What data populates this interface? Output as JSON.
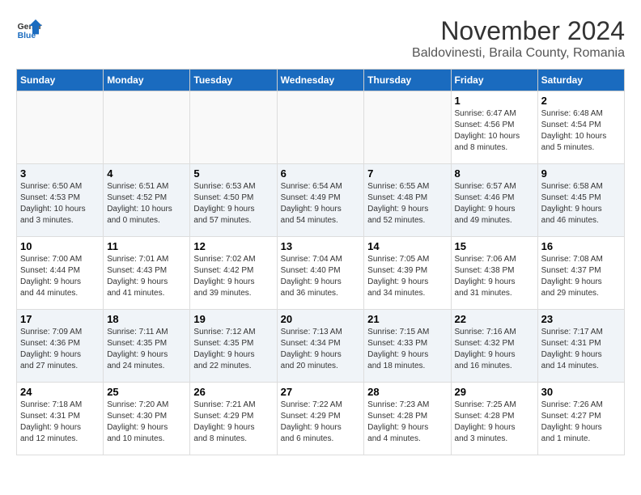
{
  "logo": {
    "general": "General",
    "blue": "Blue"
  },
  "title": "November 2024",
  "subtitle": "Baldovinesti, Braila County, Romania",
  "days_header": [
    "Sunday",
    "Monday",
    "Tuesday",
    "Wednesday",
    "Thursday",
    "Friday",
    "Saturday"
  ],
  "weeks": [
    [
      {
        "day": "",
        "info": ""
      },
      {
        "day": "",
        "info": ""
      },
      {
        "day": "",
        "info": ""
      },
      {
        "day": "",
        "info": ""
      },
      {
        "day": "",
        "info": ""
      },
      {
        "day": "1",
        "info": "Sunrise: 6:47 AM\nSunset: 4:56 PM\nDaylight: 10 hours\nand 8 minutes."
      },
      {
        "day": "2",
        "info": "Sunrise: 6:48 AM\nSunset: 4:54 PM\nDaylight: 10 hours\nand 5 minutes."
      }
    ],
    [
      {
        "day": "3",
        "info": "Sunrise: 6:50 AM\nSunset: 4:53 PM\nDaylight: 10 hours\nand 3 minutes."
      },
      {
        "day": "4",
        "info": "Sunrise: 6:51 AM\nSunset: 4:52 PM\nDaylight: 10 hours\nand 0 minutes."
      },
      {
        "day": "5",
        "info": "Sunrise: 6:53 AM\nSunset: 4:50 PM\nDaylight: 9 hours\nand 57 minutes."
      },
      {
        "day": "6",
        "info": "Sunrise: 6:54 AM\nSunset: 4:49 PM\nDaylight: 9 hours\nand 54 minutes."
      },
      {
        "day": "7",
        "info": "Sunrise: 6:55 AM\nSunset: 4:48 PM\nDaylight: 9 hours\nand 52 minutes."
      },
      {
        "day": "8",
        "info": "Sunrise: 6:57 AM\nSunset: 4:46 PM\nDaylight: 9 hours\nand 49 minutes."
      },
      {
        "day": "9",
        "info": "Sunrise: 6:58 AM\nSunset: 4:45 PM\nDaylight: 9 hours\nand 46 minutes."
      }
    ],
    [
      {
        "day": "10",
        "info": "Sunrise: 7:00 AM\nSunset: 4:44 PM\nDaylight: 9 hours\nand 44 minutes."
      },
      {
        "day": "11",
        "info": "Sunrise: 7:01 AM\nSunset: 4:43 PM\nDaylight: 9 hours\nand 41 minutes."
      },
      {
        "day": "12",
        "info": "Sunrise: 7:02 AM\nSunset: 4:42 PM\nDaylight: 9 hours\nand 39 minutes."
      },
      {
        "day": "13",
        "info": "Sunrise: 7:04 AM\nSunset: 4:40 PM\nDaylight: 9 hours\nand 36 minutes."
      },
      {
        "day": "14",
        "info": "Sunrise: 7:05 AM\nSunset: 4:39 PM\nDaylight: 9 hours\nand 34 minutes."
      },
      {
        "day": "15",
        "info": "Sunrise: 7:06 AM\nSunset: 4:38 PM\nDaylight: 9 hours\nand 31 minutes."
      },
      {
        "day": "16",
        "info": "Sunrise: 7:08 AM\nSunset: 4:37 PM\nDaylight: 9 hours\nand 29 minutes."
      }
    ],
    [
      {
        "day": "17",
        "info": "Sunrise: 7:09 AM\nSunset: 4:36 PM\nDaylight: 9 hours\nand 27 minutes."
      },
      {
        "day": "18",
        "info": "Sunrise: 7:11 AM\nSunset: 4:35 PM\nDaylight: 9 hours\nand 24 minutes."
      },
      {
        "day": "19",
        "info": "Sunrise: 7:12 AM\nSunset: 4:35 PM\nDaylight: 9 hours\nand 22 minutes."
      },
      {
        "day": "20",
        "info": "Sunrise: 7:13 AM\nSunset: 4:34 PM\nDaylight: 9 hours\nand 20 minutes."
      },
      {
        "day": "21",
        "info": "Sunrise: 7:15 AM\nSunset: 4:33 PM\nDaylight: 9 hours\nand 18 minutes."
      },
      {
        "day": "22",
        "info": "Sunrise: 7:16 AM\nSunset: 4:32 PM\nDaylight: 9 hours\nand 16 minutes."
      },
      {
        "day": "23",
        "info": "Sunrise: 7:17 AM\nSunset: 4:31 PM\nDaylight: 9 hours\nand 14 minutes."
      }
    ],
    [
      {
        "day": "24",
        "info": "Sunrise: 7:18 AM\nSunset: 4:31 PM\nDaylight: 9 hours\nand 12 minutes."
      },
      {
        "day": "25",
        "info": "Sunrise: 7:20 AM\nSunset: 4:30 PM\nDaylight: 9 hours\nand 10 minutes."
      },
      {
        "day": "26",
        "info": "Sunrise: 7:21 AM\nSunset: 4:29 PM\nDaylight: 9 hours\nand 8 minutes."
      },
      {
        "day": "27",
        "info": "Sunrise: 7:22 AM\nSunset: 4:29 PM\nDaylight: 9 hours\nand 6 minutes."
      },
      {
        "day": "28",
        "info": "Sunrise: 7:23 AM\nSunset: 4:28 PM\nDaylight: 9 hours\nand 4 minutes."
      },
      {
        "day": "29",
        "info": "Sunrise: 7:25 AM\nSunset: 4:28 PM\nDaylight: 9 hours\nand 3 minutes."
      },
      {
        "day": "30",
        "info": "Sunrise: 7:26 AM\nSunset: 4:27 PM\nDaylight: 9 hours\nand 1 minute."
      }
    ]
  ]
}
